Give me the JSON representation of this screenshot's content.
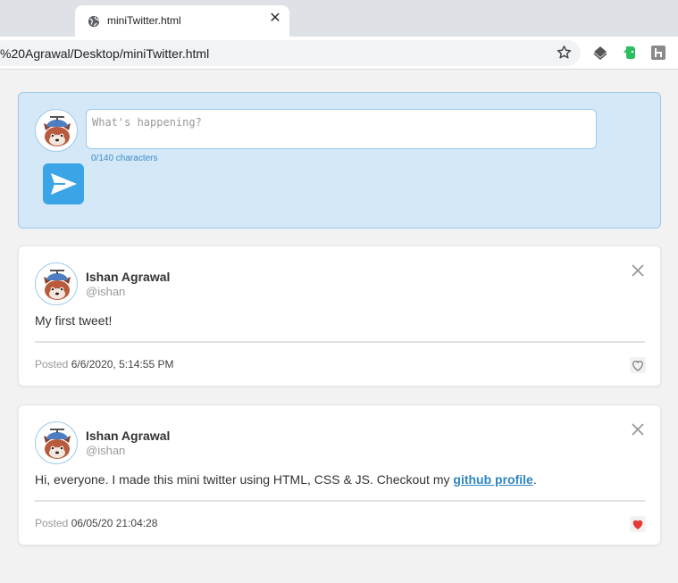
{
  "browser": {
    "tab_title": "miniTwitter.html",
    "tab_close": "✕",
    "url": "%20Agrawal/Desktop/miniTwitter.html"
  },
  "compose": {
    "placeholder": "What's happening?",
    "char_count": "0/140 characters"
  },
  "tweets": [
    {
      "name": "Ishan Agrawal",
      "handle": "@ishan",
      "text": "My first tweet!",
      "posted_label": "Posted",
      "posted_date": "6/6/2020, 5:14:55 PM",
      "liked": false
    },
    {
      "name": "Ishan Agrawal",
      "handle": "@ishan",
      "text_before": "Hi, everyone. I made this mini twitter using HTML, CSS & JS. Checkout my ",
      "link_text": "github profile",
      "text_after": ".",
      "posted_label": "Posted",
      "posted_date": "06/05/20 21:04:28",
      "liked": true
    }
  ],
  "colors": {
    "accent": "#3aa4e6",
    "compose_bg": "#d4e8f7",
    "like_red": "#e53935",
    "link": "#2e86c1"
  }
}
